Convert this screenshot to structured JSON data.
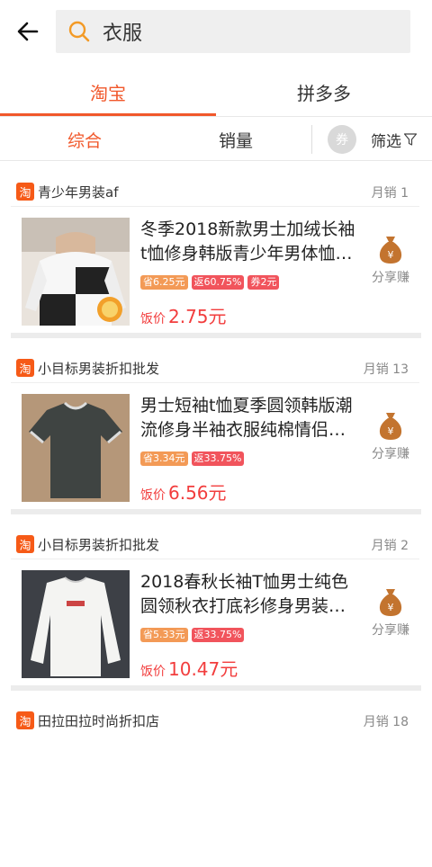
{
  "header": {
    "search_query": "衣服"
  },
  "platform_tabs": [
    {
      "label": "淘宝",
      "active": true
    },
    {
      "label": "拼多多",
      "active": false
    }
  ],
  "sort_bar": {
    "comprehensive": "综合",
    "sales": "销量",
    "coupon_toggle": "券",
    "filter": "筛选"
  },
  "colors": {
    "accent": "#f1582b",
    "price": "#f23d3d"
  },
  "products": [
    {
      "shop_badge": "淘",
      "shop": "青少年男装af",
      "monthly_sales": "月销 1",
      "title": "冬季2018新款男士加绒长袖t恤修身韩版青少年男体恤…",
      "tags": {
        "save": "省6.25元",
        "rebate": "返60.75%",
        "coupon": "券2元"
      },
      "price_label": "饭价",
      "price": "2.75元",
      "share_label": "分享赚",
      "money_symbol": "¥",
      "image_icon": "long-sleeve-tshirt-icon"
    },
    {
      "shop_badge": "淘",
      "shop": "小目标男装折扣批发",
      "monthly_sales": "月销 13",
      "title": "男士短袖t恤夏季圆领韩版潮流修身半袖衣服纯棉情侣体…",
      "tags": {
        "save": "省3.34元",
        "rebate": "返33.75%"
      },
      "price_label": "饭价",
      "price": "6.56元",
      "share_label": "分享赚",
      "money_symbol": "¥",
      "image_icon": "short-sleeve-tshirt-icon"
    },
    {
      "shop_badge": "淘",
      "shop": "小目标男装折扣批发",
      "monthly_sales": "月销 2",
      "title": "2018春秋长袖T恤男士纯色圆领秋衣打底衫修身男装体…",
      "tags": {
        "save": "省5.33元",
        "rebate": "返33.75%"
      },
      "price_label": "饭价",
      "price": "10.47元",
      "share_label": "分享赚",
      "money_symbol": "¥",
      "image_icon": "white-long-sleeve-icon"
    },
    {
      "shop_badge": "淘",
      "shop": "田拉田拉时尚折扣店",
      "monthly_sales": "月销 18"
    }
  ]
}
